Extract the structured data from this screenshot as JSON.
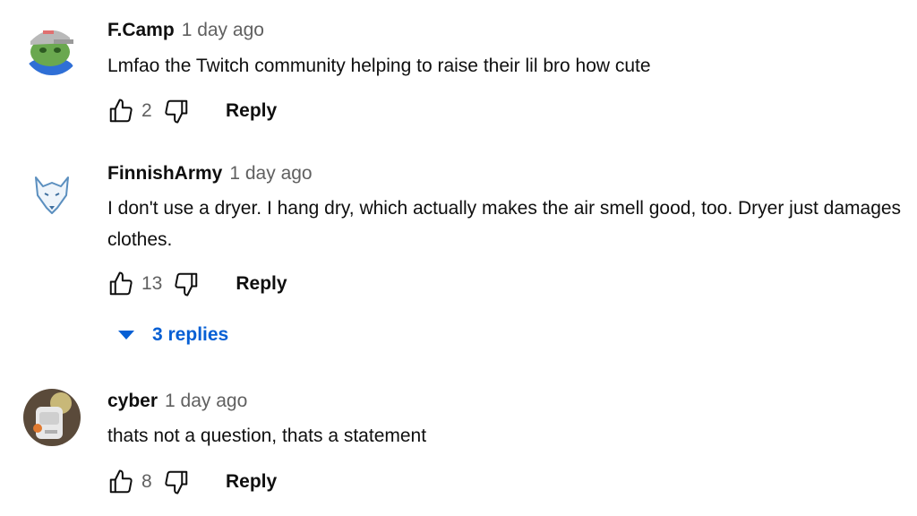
{
  "comments": [
    {
      "author": "F.Camp",
      "time": "1 day ago",
      "text": "Lmfao the Twitch community helping to raise their lil bro how cute",
      "likes": "2",
      "reply_label": "Reply",
      "avatar_icon": "frog-cap-avatar-icon"
    },
    {
      "author": "FinnishArmy",
      "time": "1 day ago",
      "text": "I don't use a dryer. I hang dry, which actually makes the air smell good, too. Dryer just damages clothes.",
      "likes": "13",
      "reply_label": "Reply",
      "avatar_icon": "wolf-avatar-icon",
      "replies_label": "3 replies"
    },
    {
      "author": "cyber",
      "time": "1 day ago",
      "text": "thats not a question, thats a statement",
      "likes": "8",
      "reply_label": "Reply",
      "avatar_icon": "cyber-avatar-icon"
    }
  ],
  "colors": {
    "link_blue": "#065fd4",
    "secondary_text": "#606060",
    "primary_text": "#0f0f0f"
  }
}
